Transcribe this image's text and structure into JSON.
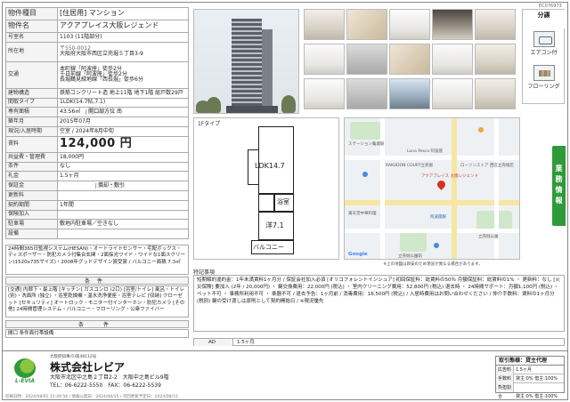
{
  "doc_code": "EC076973",
  "property": {
    "type_label": "物件種目",
    "type_value": "[住居用] マンション",
    "name_label": "物件名",
    "name_value": "アクアプレイス大阪レジェンド",
    "room_label": "号室名",
    "room_value": "1103 (11階部分)",
    "location_label": "所在地",
    "postal": "〒550-0012",
    "address": "大阪府大阪市西区立売堀５丁目3-9",
    "transport_label": "交通",
    "transport": [
      "本町線「阿波座」徒歩2分",
      "千日前線「阿波座」徒歩2分",
      "長堀鶴見緑地線「西長堀」徒歩6分"
    ],
    "structure_label": "建物構造",
    "structure_value": "鉄筋コンクリート造 地上11階 地下1階 総戸数29戸",
    "layout_label": "間取タイプ",
    "layout_value": "1LDK(14.7帖,7.1)",
    "area_label": "専有面積",
    "area_value": "43.56㎡",
    "direction_label": "開口部方位",
    "direction_value": "南",
    "built_label": "築年月",
    "built_value": "2015年07月",
    "status_label": "現況/入居時期",
    "status_value": "空室 / 2024年8月中旬",
    "rent_label": "賃料",
    "rent_value": "124,000 円",
    "mgmt_label": "共益費・管理費",
    "mgmt_value": "18,000円",
    "cond_label": "条件",
    "cond_value": "なし",
    "deposit_label": "礼金",
    "deposit_value": "1.5ヶ月",
    "shiki_label": "保証金",
    "shiki_value": "",
    "shokyaku_label": "償却・敷引",
    "shokyaku_value": "",
    "renewal_label": "更新料",
    "renewal_value": "",
    "contract_label": "契約期間",
    "contract_value": "1年間",
    "insurance_label": "保険加入",
    "insurance_value": "",
    "parking_label": "駐車場",
    "parking_value": "敷地内駐車場／空きなし",
    "equip_label": "設備",
    "equipment": "24時間365日監視システム(HESAN)・オートライトセンサー・宅配ボックス・ディスポーザー・防犯カメラ付集合玄関・2面採光ワイド・ワイドな1面スクリーン(1520x735サイズ)・2008年グッドデザイン賞受賞 / バルコニー面積 7.3㎡",
    "conditions_label": "条件",
    "conditions": "[交通] 内廊下・最上階 [キッチン] ガスコンロ (2口) [浴室/トイレ] 風呂・トイレ (別)・洗面所 (独立) ・浴室乾燥機・温水洗浄便座・浴室テレビ [収納] クローゼット [セキュリティ] オートロック・モニター付インターホン・防犯カメラ [その他] 24時間管理システム・バルコニー・フローリング・公衆ファイバー",
    "notes_label": "条　件",
    "notes_value": "間口 条件面付帯設備"
  },
  "features": {
    "title": "分譲",
    "items": [
      {
        "label": "エアコン付",
        "icon": "aircon-icon"
      },
      {
        "label": "フローリング",
        "icon": "flooring-icon"
      }
    ]
  },
  "floorplan": {
    "label": "1Fタイプ",
    "rooms": {
      "ldk": "LDK14.7",
      "bath": "浴室",
      "room": "洋7.1",
      "balcony": "バルコニー"
    }
  },
  "map": {
    "labels": [
      "ステーション亀城駅",
      "RAKUDON COURT立売堀",
      "Luna Pescx 阿波座",
      "アクアプレイス 大阪レジェンド",
      "ローソンストア 西区立売堀店",
      "立売堀公園",
      "萬天堂中華料理",
      "阿波座駅",
      "立売堀公園前"
    ],
    "copyright": "Google",
    "note": "※上の地図は目安のため現況が異なる場合があります。"
  },
  "side_tab": "業務情報",
  "remarks": {
    "label": "特記事項",
    "text": "短期解約違約金：1年未満賃料1ヶ月分 / 保証会社加入必須 [オリコフォレントインシュア] 初回保証料：総賃料の50％ 月額保証料：総賃料の1% ・ 更新料：なし [火災保険] 要加入 (2年 / 20,000円) ・ 鍵交換費用：22,000円 (税込) ・ 室内クリーニング費用：52,800円 (税込) 退去時 ・ 24時間サポート：月額1,100円 (税込) ・ ペット不可 ・ 事務所利用不可 ・ 楽器不可 / 退去予告：1ヶ月前 / 消毒費用：16,500円 (税込) / 入居時費用はお問い合わせください / 仲介手数料：賃料の1ヶ月分 (税別) 鍵の受け渡しは原則として契約開始日 / ※現況優先",
    "ad_label": "AD",
    "ad_value": "1.5ヶ月"
  },
  "company": {
    "license": "大阪府知事(5)第48112号",
    "name": "株式会社レビア",
    "address": "大阪市北区中之島２丁目2-2　大阪中之島ビル9階",
    "tel": "TEL：06-6222-5550　FAX：06-6222-5539",
    "logo_text": "L-EVIA",
    "printed": "印刷日時：2024/08/01 15:49:56 / 情報公開日：2024/08/15 / 次回更新予定日：2024/08/15"
  },
  "deal": {
    "title": "取引態様：貸主代理",
    "rows": [
      {
        "k": "広告料",
        "v": "1.5ヶ月"
      },
      {
        "k": "手数料",
        "v": "貸主:0% 借主:100%"
      },
      {
        "k": "負担割合",
        "v": "貸主:0% 借主:100%"
      }
    ]
  }
}
